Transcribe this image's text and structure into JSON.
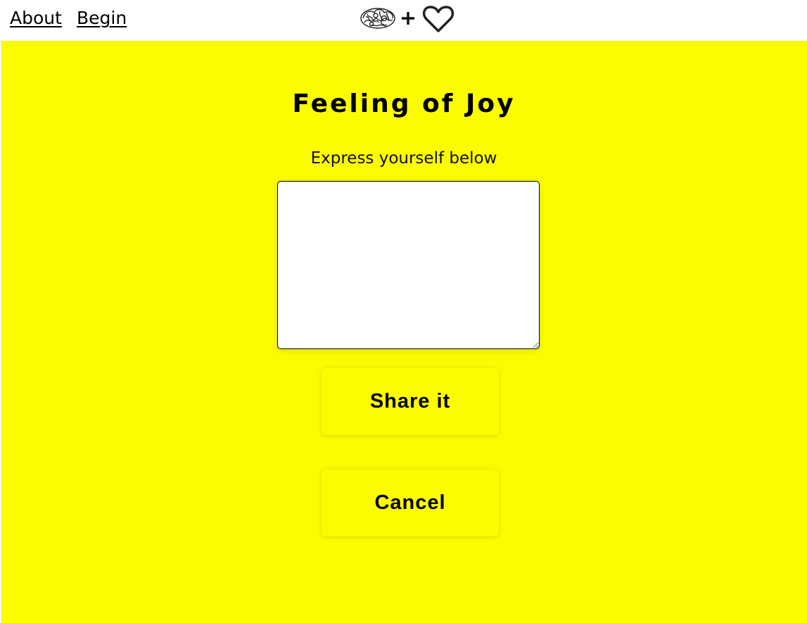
{
  "nav": {
    "about_label": "About",
    "begin_label": "Begin",
    "logo": {
      "icons": [
        "brain-icon",
        "plus-icon",
        "heart-icon"
      ],
      "plus_text": "+"
    }
  },
  "main": {
    "background_color": "#fcfc00",
    "title": "Feeling of Joy",
    "prompt": "Express yourself below",
    "textarea": {
      "value": "",
      "placeholder": ""
    },
    "share_label": "Share it",
    "cancel_label": "Cancel"
  }
}
